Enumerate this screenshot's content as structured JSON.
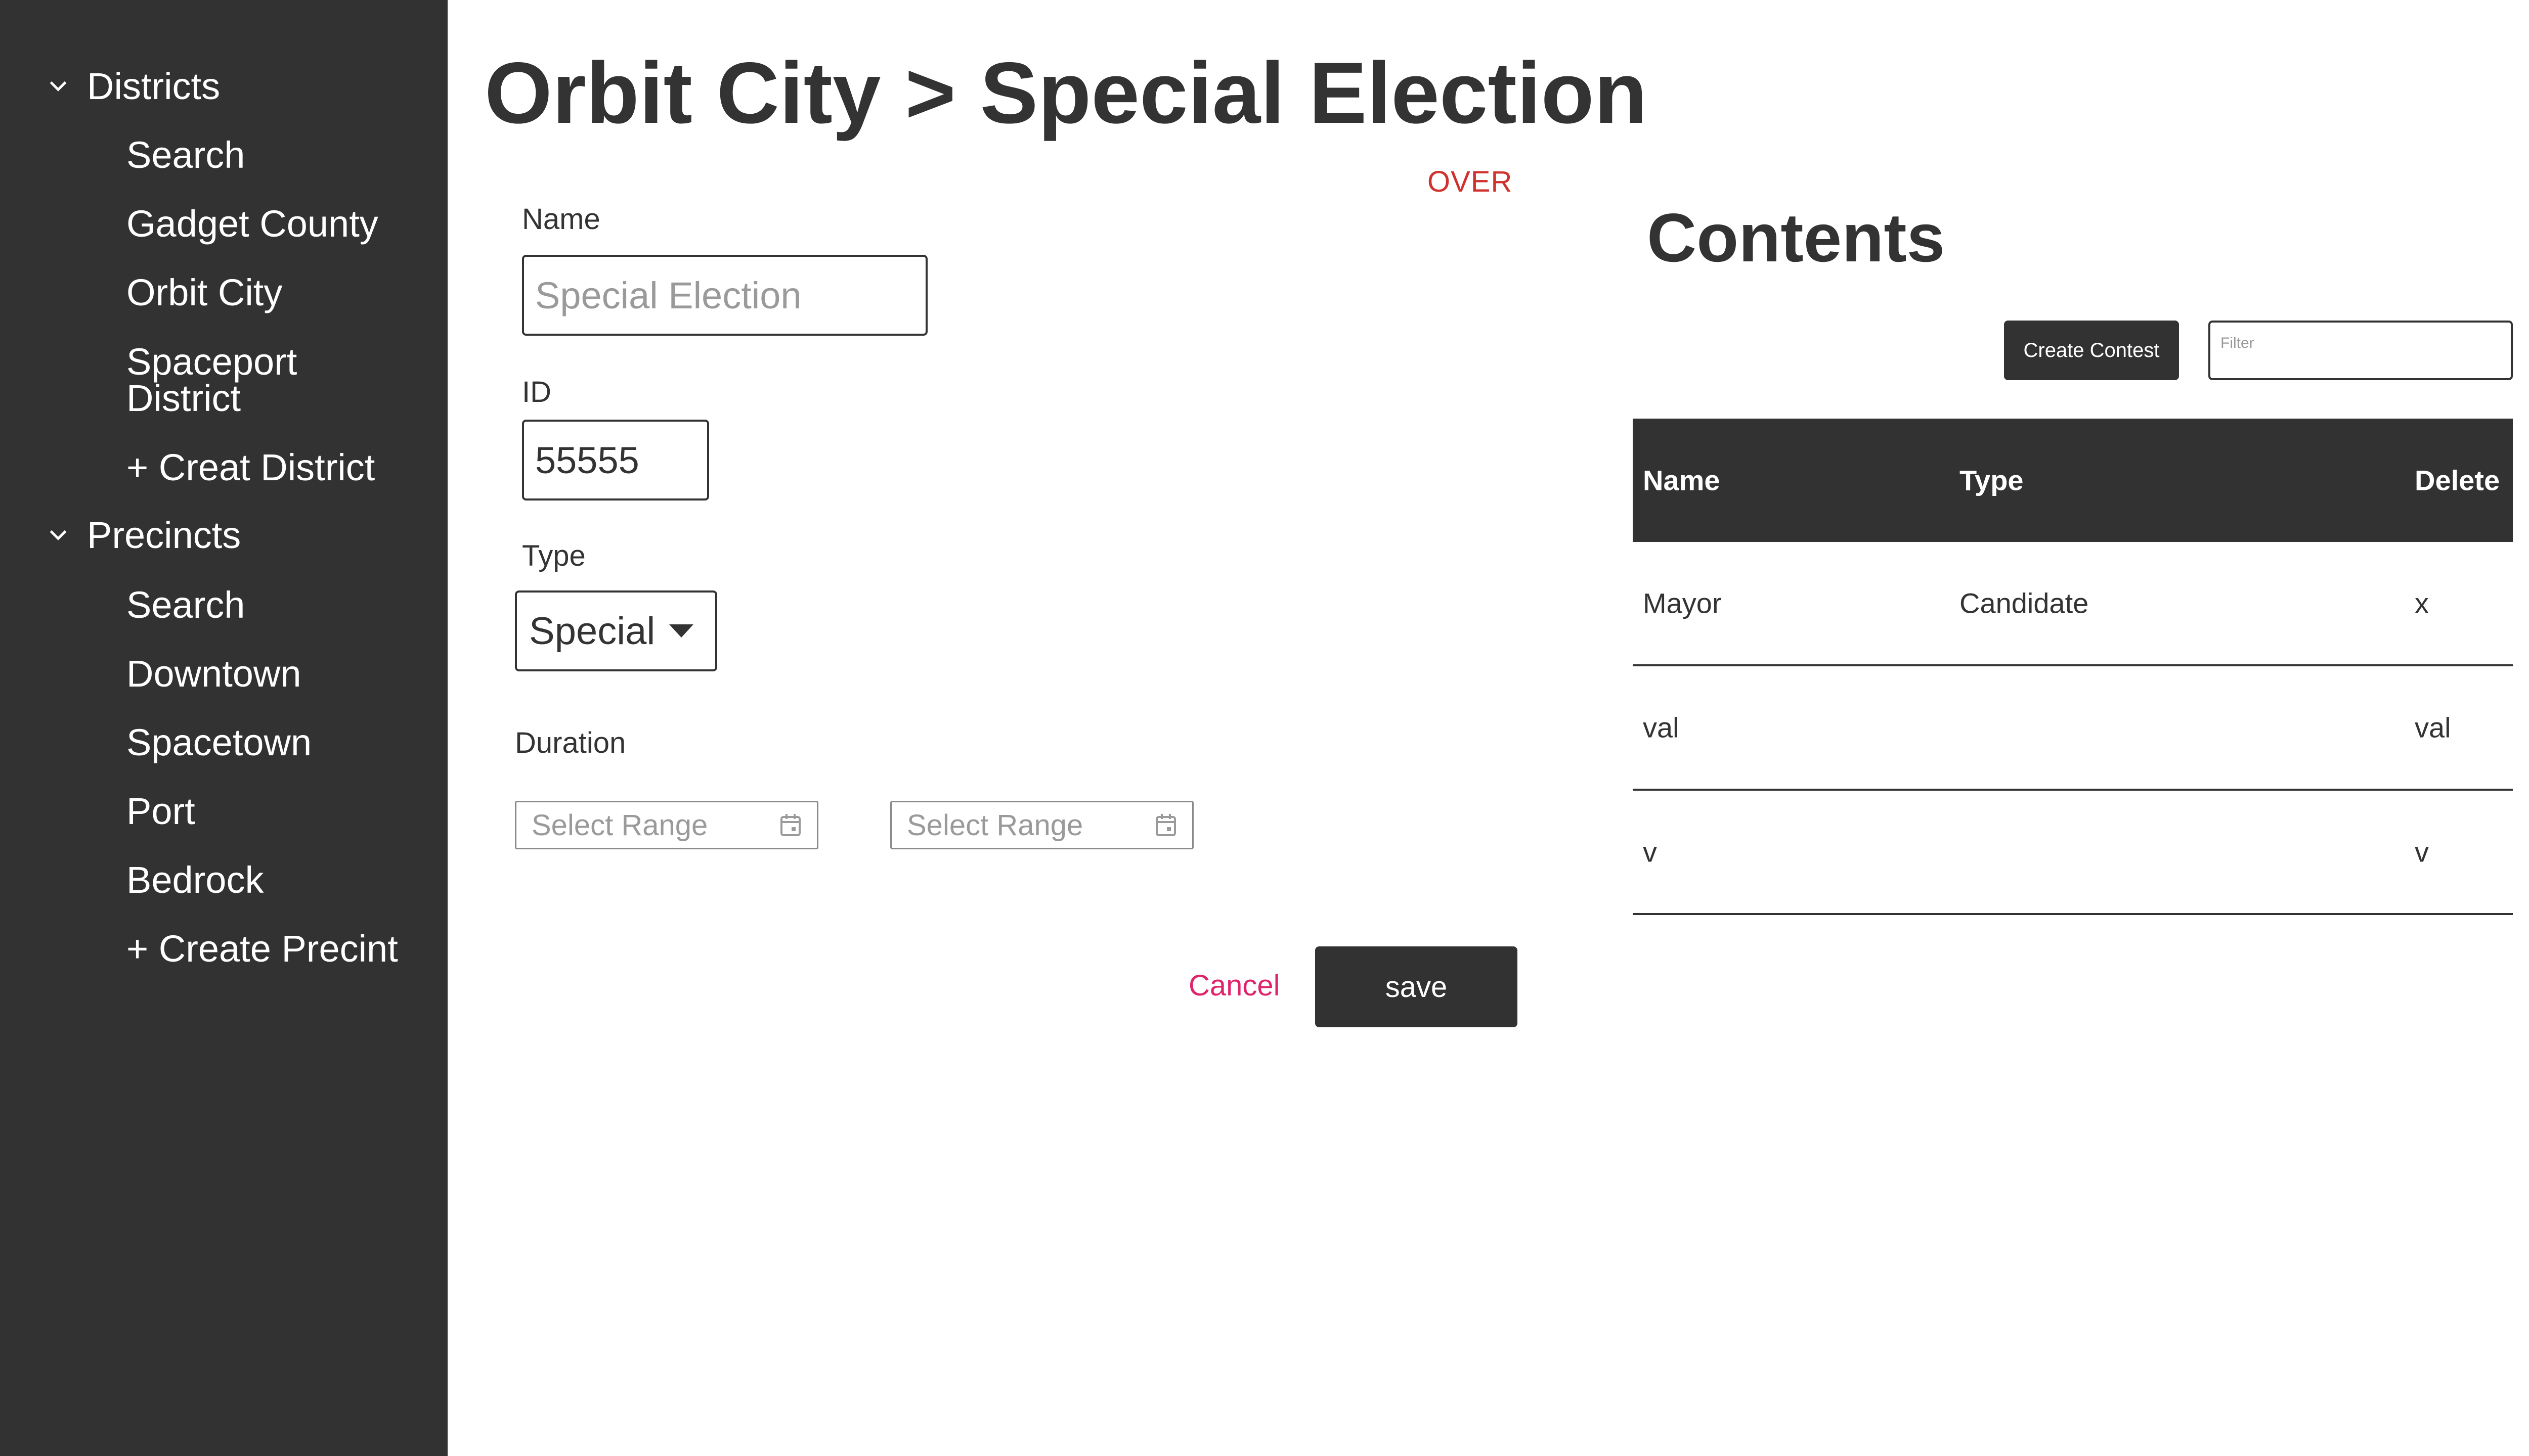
{
  "sidebar": {
    "districts": {
      "label": "Districts",
      "items": [
        "Search",
        "Gadget County",
        "Orbit City",
        "Spaceport District",
        "+ Creat District"
      ]
    },
    "precincts": {
      "label": "Precincts",
      "items": [
        "Search",
        "Downtown",
        "Spacetown",
        "Port",
        "Bedrock",
        "+ Create Precint"
      ]
    }
  },
  "header": {
    "title": "Orbit City > Special Election",
    "status": "OVER"
  },
  "form": {
    "name_label": "Name",
    "name_placeholder": "Special Election",
    "id_label": "ID",
    "id_value": "55555",
    "type_label": "Type",
    "type_value": "Special",
    "duration_label": "Duration",
    "start_placeholder": "Select Range",
    "end_placeholder": "Select Range",
    "cancel_label": "Cancel",
    "save_label": "save"
  },
  "contents": {
    "title": "Contents",
    "create_label": "Create Contest",
    "filter_placeholder": "Filter",
    "columns": {
      "name": "Name",
      "type": "Type",
      "delete": "Delete"
    },
    "rows": [
      {
        "name": "Mayor",
        "type": "Candidate",
        "delete": "x"
      },
      {
        "name": "val",
        "type": "",
        "delete": "val"
      },
      {
        "name": "v",
        "type": "",
        "delete": "v"
      }
    ]
  },
  "colors": {
    "sidebar_bg": "#323232",
    "status_red": "#d0312d",
    "cancel_pink": "#e0246b"
  },
  "icons": {
    "group_toggle": "chevron-down-icon",
    "date_picker": "calendar-icon",
    "select_caret": "caret-down-icon"
  }
}
